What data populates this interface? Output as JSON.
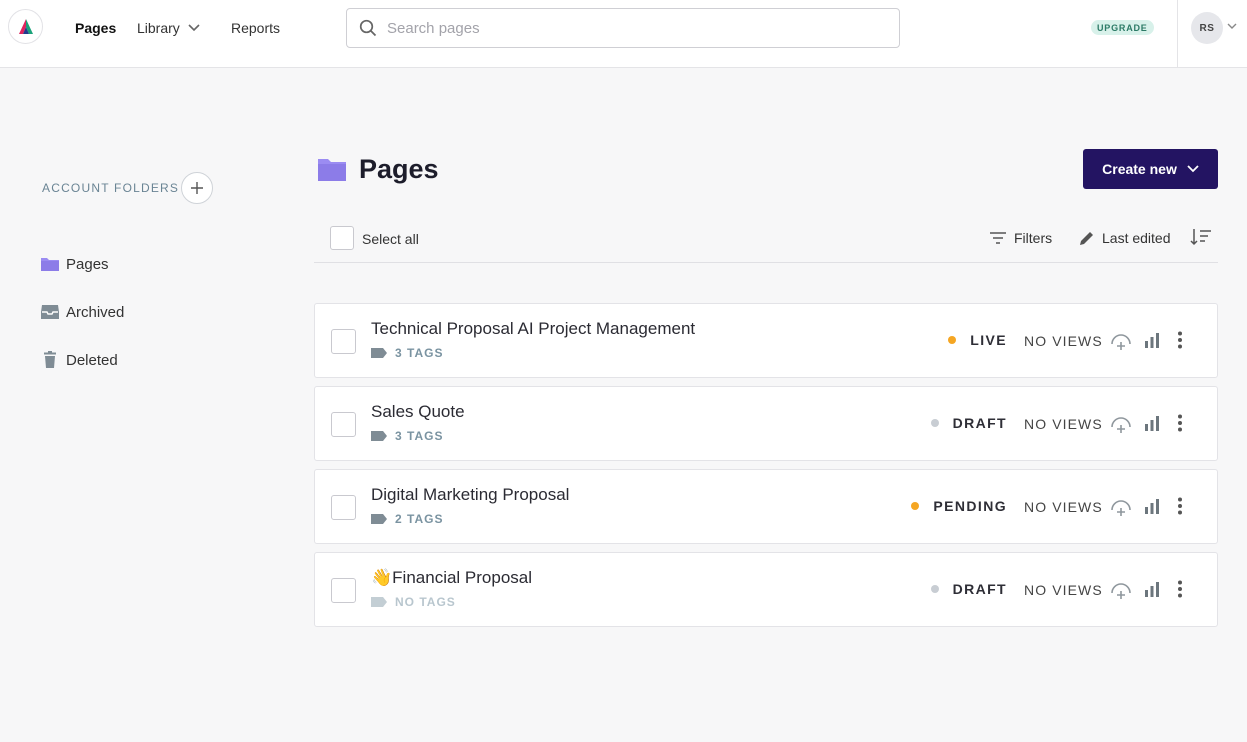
{
  "header": {
    "nav": {
      "pages": "Pages",
      "library": "Library",
      "reports": "Reports"
    },
    "search": {
      "placeholder": "Search pages"
    },
    "upgrade": "UPGRADE",
    "avatar": "RS"
  },
  "sidebar": {
    "section_label": "ACCOUNT FOLDERS",
    "items": [
      {
        "label": "Pages",
        "icon": "folder-icon"
      },
      {
        "label": "Archived",
        "icon": "archive-icon"
      },
      {
        "label": "Deleted",
        "icon": "trash-icon"
      }
    ]
  },
  "main": {
    "title": "Pages",
    "create_button": "Create new",
    "toolbar": {
      "select_all": "Select all",
      "filters": "Filters",
      "sort": "Last edited"
    },
    "rows": [
      {
        "title": "Technical Proposal AI Project Management",
        "tags": "3 TAGS",
        "status": "LIVE",
        "status_color": "#f5a623",
        "views": "NO VIEWS"
      },
      {
        "title": "Sales Quote",
        "tags": "3 TAGS",
        "status": "DRAFT",
        "status_color": "#c8cdd3",
        "views": "NO VIEWS"
      },
      {
        "title": "Digital Marketing Proposal",
        "tags": "2 TAGS",
        "status": "PENDING",
        "status_color": "#f5a623",
        "views": "NO VIEWS"
      },
      {
        "title": "👋Financial Proposal",
        "tags": "NO TAGS",
        "status": "DRAFT",
        "status_color": "#c8cdd3",
        "views": "NO VIEWS"
      }
    ]
  },
  "colors": {
    "brand_primary": "#231462",
    "folder": "#9b8cf2",
    "accent_orange": "#f5a623"
  }
}
